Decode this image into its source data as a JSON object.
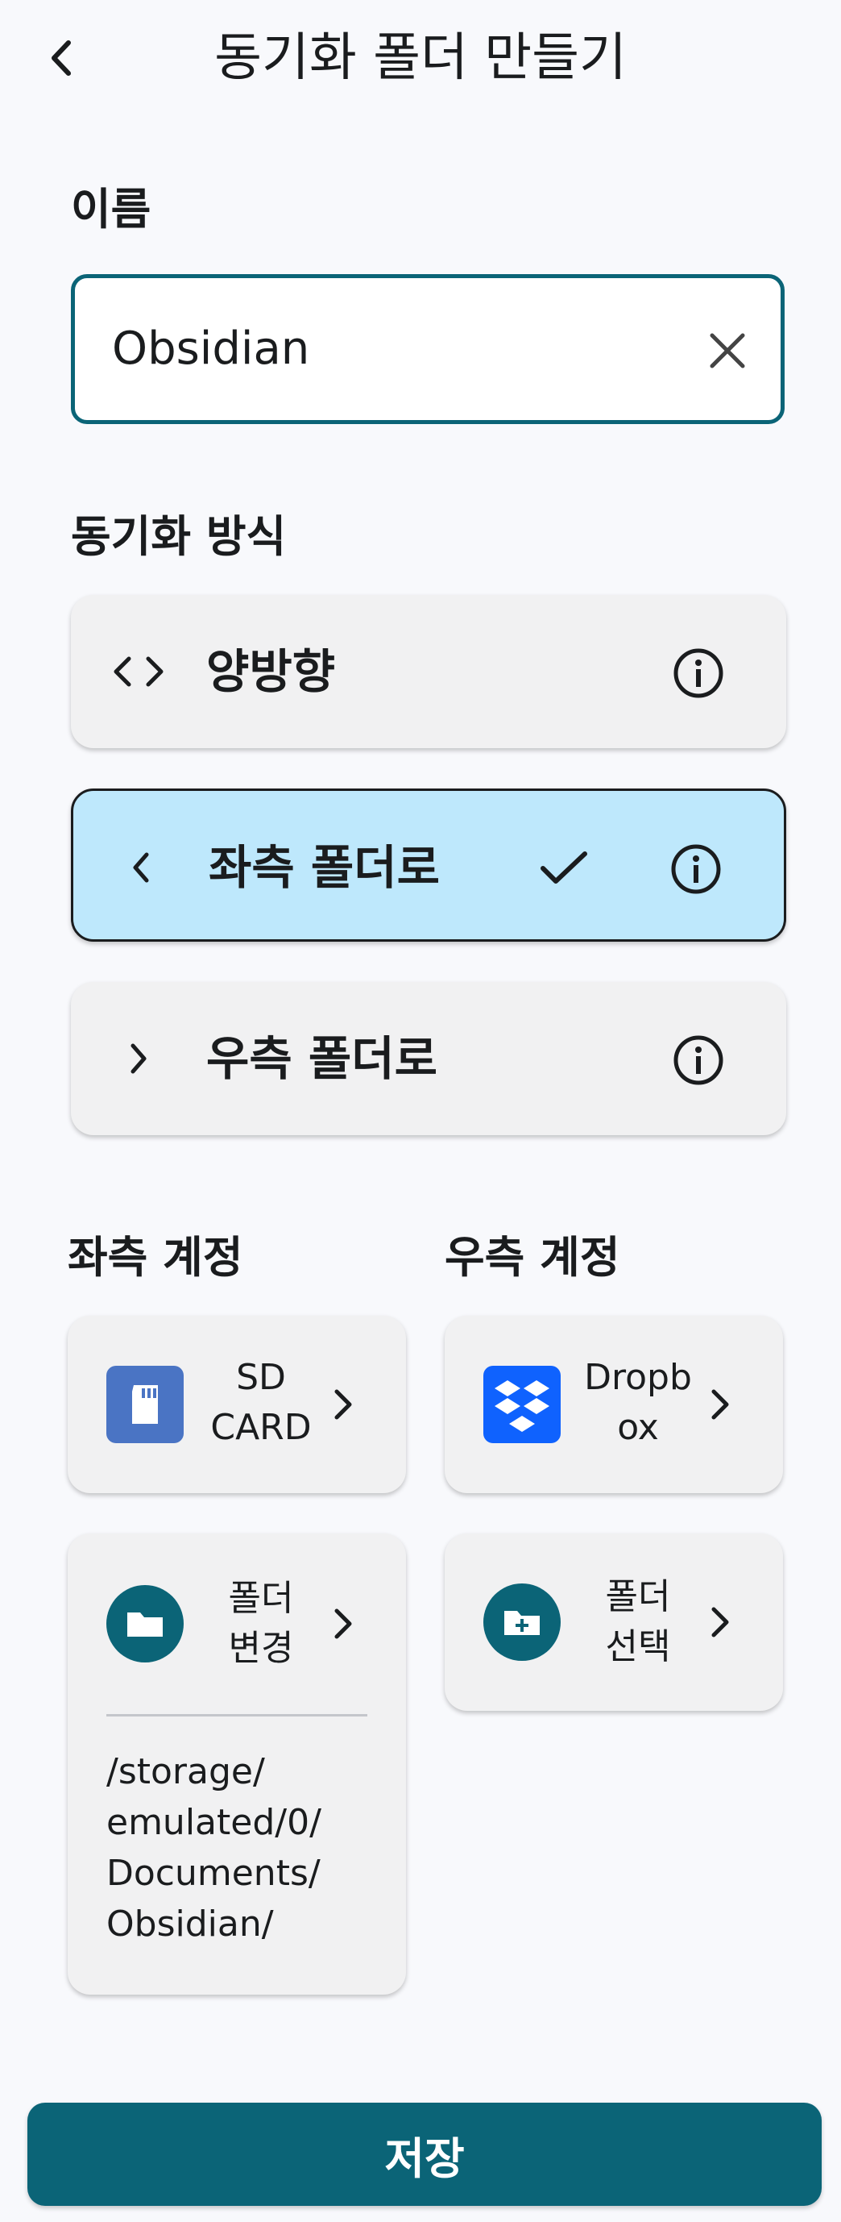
{
  "header": {
    "title": "동기화 폴더 만들기",
    "back_icon": "chevron-left-icon"
  },
  "name_section": {
    "label": "이름",
    "value": "Obsidian",
    "clear_icon": "close-icon"
  },
  "sync_section": {
    "label": "동기화 방식",
    "options": [
      {
        "label": "양방향",
        "icon": "code-brackets-icon",
        "selected": false
      },
      {
        "label": "좌측 폴더로",
        "icon": "chevron-left-icon",
        "selected": true
      },
      {
        "label": "우측 폴더로",
        "icon": "chevron-right-icon",
        "selected": false
      }
    ]
  },
  "left_account": {
    "label": "좌측 계정",
    "account_text": "SD\nCARD",
    "folder_button": "폴더\n변경",
    "path": "/storage/\nemulated/0/\nDocuments/\nObsidian/"
  },
  "right_account": {
    "label": "우측 계정",
    "account_text": "Dropb\nox",
    "folder_button": "폴더\n선택"
  },
  "save_button": "저장",
  "colors": {
    "accent": "#0b6477",
    "selected_bg": "#bee8fc",
    "card_bg": "#f1f1f2",
    "page_bg": "#f8f9fc",
    "sd_card_icon": "#4a74c4",
    "dropbox_icon": "#0f62fe"
  }
}
